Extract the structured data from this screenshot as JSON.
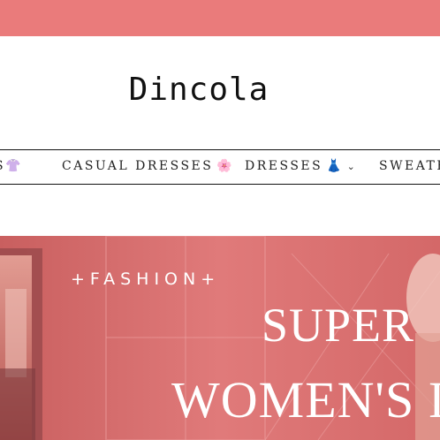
{
  "announcement_bar": {
    "color": "#ea7b7b"
  },
  "header": {
    "logo_text": "Dincola"
  },
  "nav": {
    "items": [
      {
        "label": "S",
        "emoji": "👚"
      },
      {
        "label": "CASUAL DRESSES",
        "emoji": "🌸"
      },
      {
        "label": "DRESSES",
        "emoji": "👗",
        "chevron": "⌄"
      },
      {
        "label": "SWEATER"
      }
    ]
  },
  "hero": {
    "background": "#d96b6b",
    "eyebrow": "+FASHION+",
    "headline_line1": "SUPER",
    "headline_line2": "WOMEN'S I"
  }
}
